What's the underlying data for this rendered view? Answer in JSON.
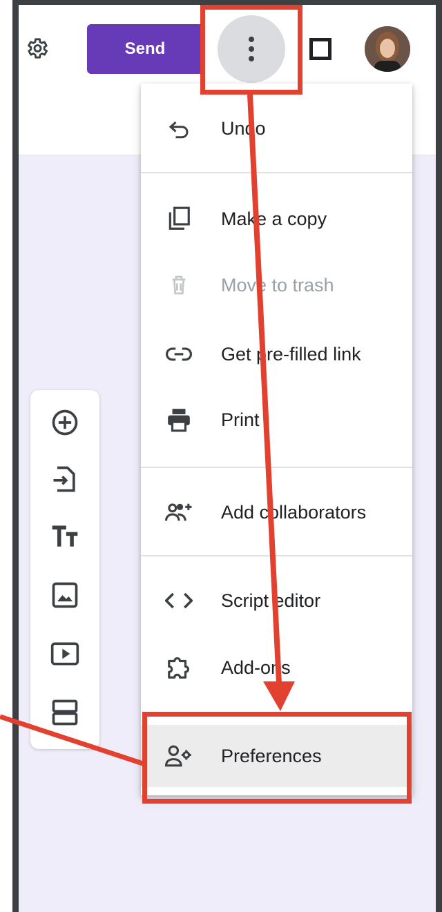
{
  "header": {
    "send_label": "Send",
    "settings_icon": "gear-icon",
    "more_icon": "more-vert-icon",
    "preview_icon": "square-icon",
    "avatar_icon": "avatar"
  },
  "menu": {
    "items": [
      {
        "label": "Undo",
        "icon": "undo-icon",
        "enabled": true
      },
      {
        "label": "Make a copy",
        "icon": "copy-icon",
        "enabled": true
      },
      {
        "label": "Move to trash",
        "icon": "trash-icon",
        "enabled": false
      },
      {
        "label": "Get pre-filled link",
        "icon": "link-icon",
        "enabled": true
      },
      {
        "label": "Print",
        "icon": "printer-icon",
        "enabled": true
      },
      {
        "label": "Add collaborators",
        "icon": "add-people-icon",
        "enabled": true
      },
      {
        "label": "Script editor",
        "icon": "code-icon",
        "enabled": true
      },
      {
        "label": "Add-ons",
        "icon": "puzzle-icon",
        "enabled": true
      },
      {
        "label": "Preferences",
        "icon": "person-settings-icon",
        "enabled": true,
        "highlighted": true
      }
    ]
  },
  "side_toolbar": {
    "icons": [
      "add-question-icon",
      "import-questions-icon",
      "title-text-icon",
      "image-icon",
      "video-icon",
      "section-icon"
    ]
  },
  "colors": {
    "accent": "#673ab7",
    "annotation": "#e3412f",
    "canvas": "#efedf9"
  }
}
